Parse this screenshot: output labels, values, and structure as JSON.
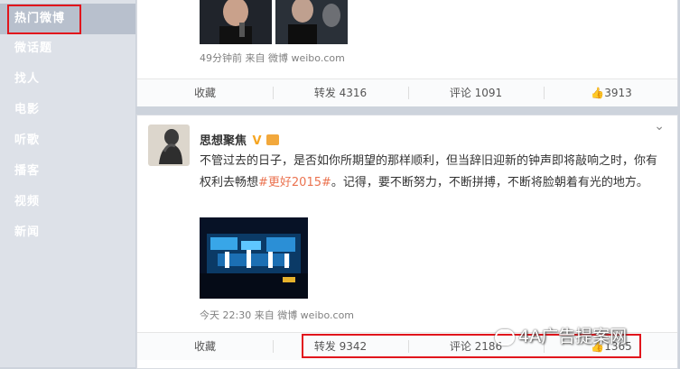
{
  "sidebar": {
    "items": [
      {
        "label": "热门微博"
      },
      {
        "label": "微话题"
      },
      {
        "label": "找人"
      },
      {
        "label": "电影"
      },
      {
        "label": "听歌"
      },
      {
        "label": "播客"
      },
      {
        "label": "视频"
      },
      {
        "label": "新闻"
      }
    ]
  },
  "post1": {
    "meta": "49分钟前 来自 微博 weibo.com",
    "actions": {
      "collect": "收藏",
      "repost": "转发 4316",
      "comment": "评论 1091",
      "like": "3913"
    }
  },
  "post2": {
    "author": "思想聚焦",
    "text_a": "不管过去的日子，是否如你所期望的那样顺利，但当辞旧迎新的钟声即将敲响之时，你有权利去畅想",
    "tag": "#更好2015#",
    "text_b": "。记得，要不断努力，不断拼搏，不断将脸朝着有光的地方。",
    "meta": "今天 22:30 来自 微博 weibo.com",
    "actions": {
      "collect": "收藏",
      "repost": "转发 9342",
      "comment": "评论 2186",
      "like": "1365"
    }
  },
  "watermark": "4A广告提案网",
  "colors": {
    "highlight": "#e1151c",
    "tag": "#eb7350",
    "vip": "#f6a623"
  }
}
